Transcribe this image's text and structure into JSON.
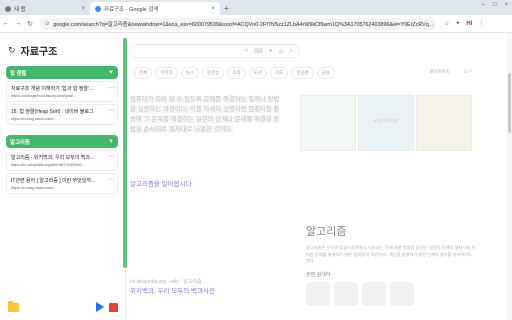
{
  "tabs": [
    {
      "label": "새 탭",
      "active": false
    },
    {
      "label": "자료구조 - Google 검색",
      "active": true
    }
  ],
  "toolbar": {
    "url": "google.com/search?q=알고리즘&newwindow=1&sca_esv=600079539&sxsrf=ACQVn0-2Ff7NSzz1ZLbA4rW9kCf6wm1Q%3A1705762403896&ei=Y9ErZcRVq...",
    "profile": "Hi"
  },
  "google": {
    "chips": [
      "전체",
      "이미지",
      "뉴스",
      "동영상",
      "쇼핑",
      "도서",
      "지도",
      "항공편",
      "금융"
    ],
    "tools_label": "도구",
    "safesearch_label": "세이프서치",
    "snippet": "컴퓨터가 따라 할 수 있도록 문제를 해결하는 절차나 방법을 설명하는 과정이다. 이를 자세히 설명하면 컴퓨터를 활용해 그 문제를 해결하는 일련의 단계나 문제를 해결할 방법을 순서대로 절차대로 나열한 것이다.",
    "more_link": "알고리즘을 알아봅시다",
    "image_caption": "algorithm",
    "kp_title": "알고리즘",
    "kp_desc": "알고리즘은 수학과 컴퓨터과학에서 사용되는, 문제 해결 방법을 정의한 '일련의 단계적 절차'이자 어떠한 문제를 해결하기 위한 '동작들의 모임'이다. 계산을 실행하기 위한 단계적 절차를 의미하기도 한다.",
    "kp_related": "관련 검색어",
    "result2_title": "위키백과, 우리 모두의 백과사전",
    "result2_src": "ko.wikipedia.org › wiki › 알고리즘"
  },
  "sidebar": {
    "title": "자료구조",
    "sections": [
      {
        "label": "힙 정렬",
        "items": [
          {
            "title": "자료구조 개념 이해하기 '힙과 힙 정렬'...",
            "url": "https://codingschool.tistory.com/post/..."
          },
          {
            "title": "18. 힙 정렬(Heap Sort) : 네이버 블로그",
            "url": "https://m.blog.naver.com/..."
          }
        ]
      },
      {
        "label": "알고리즘",
        "items": [
          {
            "title": "알고리즘 - 위키백과, 우리 모두의 백과...",
            "url": "https://ko.wikipedia.org/wiki/%EC%95%8C..."
          },
          {
            "title": "IT관련 용어 [ 알고리즘 ] 이란 무엇일까...",
            "url": "https://m.blog.naver.com/..."
          }
        ]
      }
    ]
  },
  "colors": {
    "accent": "#43b86a",
    "play": "#1a73e8",
    "stop": "#e0433a"
  }
}
